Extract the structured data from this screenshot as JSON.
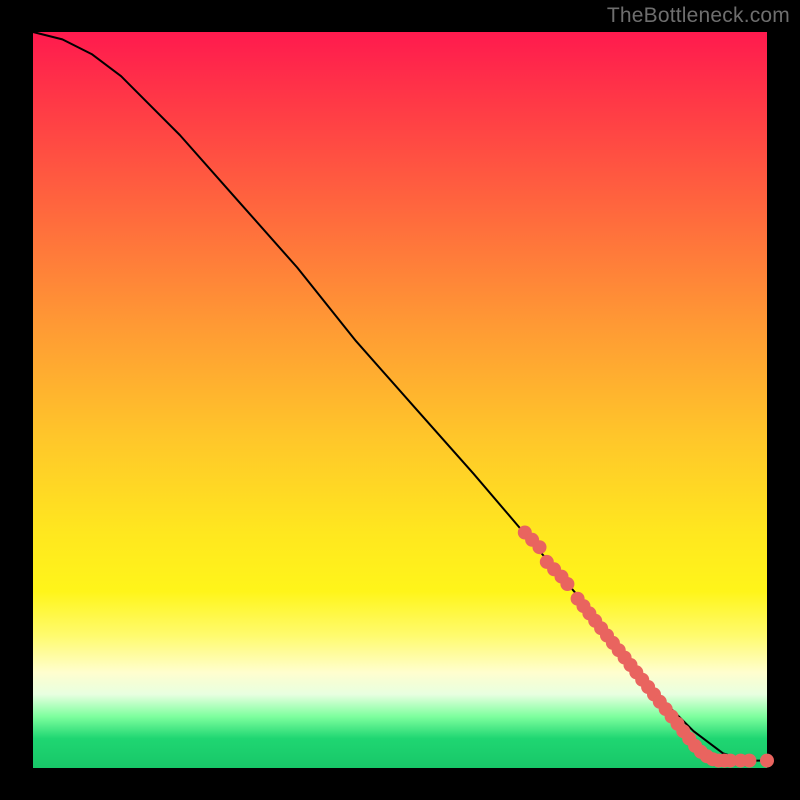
{
  "watermark": "TheBottleneck.com",
  "chart_data": {
    "type": "line",
    "title": "",
    "xlabel": "",
    "ylabel": "",
    "xlim": [
      0,
      100
    ],
    "ylim": [
      0,
      100
    ],
    "grid": false,
    "legend": false,
    "series": [
      {
        "name": "curve",
        "color": "#000000",
        "stroke_width": 2,
        "x": [
          0,
          4,
          8,
          12,
          16,
          20,
          28,
          36,
          44,
          52,
          60,
          66,
          72,
          78,
          82,
          86,
          90,
          94,
          97,
          100
        ],
        "y": [
          100,
          99,
          97,
          94,
          90,
          86,
          77,
          68,
          58,
          49,
          40,
          33,
          26,
          19,
          14,
          9,
          5,
          2,
          1,
          1
        ]
      }
    ],
    "scatter": {
      "name": "dots",
      "color": "#e9645f",
      "radius_px": 7,
      "points": [
        {
          "x": 67,
          "y": 32
        },
        {
          "x": 68,
          "y": 31
        },
        {
          "x": 69,
          "y": 30
        },
        {
          "x": 70,
          "y": 28
        },
        {
          "x": 71,
          "y": 27
        },
        {
          "x": 72,
          "y": 26
        },
        {
          "x": 72.8,
          "y": 25
        },
        {
          "x": 74.2,
          "y": 23
        },
        {
          "x": 75,
          "y": 22
        },
        {
          "x": 75.8,
          "y": 21
        },
        {
          "x": 76.6,
          "y": 20
        },
        {
          "x": 77.4,
          "y": 19
        },
        {
          "x": 78.2,
          "y": 18
        },
        {
          "x": 79,
          "y": 17
        },
        {
          "x": 79.8,
          "y": 16
        },
        {
          "x": 80.6,
          "y": 15
        },
        {
          "x": 81.4,
          "y": 14
        },
        {
          "x": 82.2,
          "y": 13
        },
        {
          "x": 83,
          "y": 12
        },
        {
          "x": 83.8,
          "y": 11
        },
        {
          "x": 84.6,
          "y": 10
        },
        {
          "x": 85.4,
          "y": 9
        },
        {
          "x": 86.2,
          "y": 8
        },
        {
          "x": 87,
          "y": 7
        },
        {
          "x": 87.8,
          "y": 6
        },
        {
          "x": 88.6,
          "y": 5
        },
        {
          "x": 89.4,
          "y": 4
        },
        {
          "x": 90.2,
          "y": 3
        },
        {
          "x": 91,
          "y": 2.2
        },
        {
          "x": 91.8,
          "y": 1.6
        },
        {
          "x": 92.6,
          "y": 1.2
        },
        {
          "x": 93.4,
          "y": 1
        },
        {
          "x": 94.2,
          "y": 1
        },
        {
          "x": 95,
          "y": 1
        },
        {
          "x": 96.4,
          "y": 1
        },
        {
          "x": 97.6,
          "y": 1
        },
        {
          "x": 100,
          "y": 1
        }
      ]
    }
  }
}
